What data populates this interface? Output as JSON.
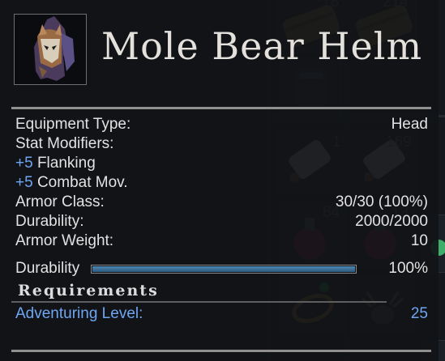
{
  "item": {
    "name": "Mole Bear Helm",
    "icon": "mole-bear-helm-icon"
  },
  "stats": {
    "equipment_type": {
      "label": "Equipment Type:",
      "value": "Head"
    },
    "stat_modifiers_label": "Stat Modifiers:",
    "modifiers": [
      {
        "value": "+5",
        "name": "Flanking"
      },
      {
        "value": "+5",
        "name": "Combat Mov."
      }
    ],
    "armor_class": {
      "label": "Armor Class:",
      "value": "30/30 (100%)"
    },
    "durability": {
      "label": "Durability:",
      "value": "2000/2000"
    },
    "armor_weight": {
      "label": "Armor Weight:",
      "value": "10"
    }
  },
  "durability_bar": {
    "label": "Durability",
    "percent": 100,
    "value_text": "100%"
  },
  "requirements": {
    "title": "Requirements",
    "items": [
      {
        "label": "Adventuring Level:",
        "value": "25"
      }
    ]
  },
  "background": {
    "counts": [
      "18",
      "214",
      "1",
      "169",
      "84",
      "13"
    ]
  },
  "colors": {
    "accent_blue": "#6fa6f2",
    "text": "#e2e2e2",
    "title": "#e4e1dc",
    "bar_fill": "#3d77a5"
  }
}
